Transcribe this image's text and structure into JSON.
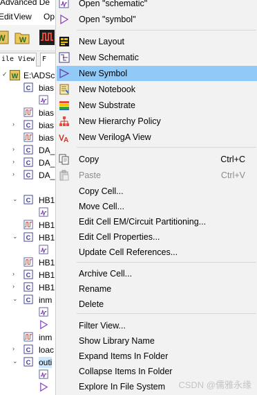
{
  "app": {
    "title_fragment": "Advanced De",
    "menu": [
      "Edit",
      "View",
      "Op"
    ],
    "tabs": [
      "ile View",
      "F"
    ]
  },
  "tree": {
    "root_label": "E:\\ADSc",
    "rows": [
      {
        "label": "bias"
      },
      {
        "label": ""
      },
      {
        "label": "bias"
      },
      {
        "label": "bias"
      },
      {
        "label": "bias"
      },
      {
        "label": "DA_"
      },
      {
        "label": "DA_"
      },
      {
        "label": "DA_"
      },
      {
        "label": "HB1"
      },
      {
        "label": ""
      },
      {
        "label": "HB1"
      },
      {
        "label": "HB1"
      },
      {
        "label": ""
      },
      {
        "label": "HB1"
      },
      {
        "label": "HB1"
      },
      {
        "label": "HB1"
      },
      {
        "label": "inm"
      },
      {
        "label": ""
      },
      {
        "label": ""
      },
      {
        "label": "inm"
      },
      {
        "label": "loac"
      },
      {
        "label": "outi"
      },
      {
        "label": ""
      },
      {
        "label": ""
      }
    ]
  },
  "context_menu": {
    "items": [
      {
        "label": "Open \"schematic\"",
        "icon": "schematic-view-icon",
        "disabled": false,
        "shortcut": ""
      },
      {
        "label": "Open \"symbol\"",
        "icon": "symbol-view-icon",
        "disabled": false,
        "shortcut": ""
      },
      {
        "label": "New Layout",
        "icon": "layout-icon",
        "disabled": false,
        "shortcut": ""
      },
      {
        "label": "New Schematic",
        "icon": "schematic-icon",
        "disabled": false,
        "shortcut": ""
      },
      {
        "label": "New Symbol",
        "icon": "symbol-icon",
        "disabled": false,
        "shortcut": "",
        "highlighted": true
      },
      {
        "label": "New Notebook",
        "icon": "notebook-icon",
        "disabled": false,
        "shortcut": ""
      },
      {
        "label": "New Substrate",
        "icon": "substrate-icon",
        "disabled": false,
        "shortcut": ""
      },
      {
        "label": "New Hierarchy Policy",
        "icon": "hierarchy-icon",
        "disabled": false,
        "shortcut": ""
      },
      {
        "label": "New VerilogA View",
        "icon": "veriloga-icon",
        "disabled": false,
        "shortcut": ""
      },
      {
        "label": "Copy",
        "icon": "copy-icon",
        "disabled": false,
        "shortcut": "Ctrl+C"
      },
      {
        "label": "Paste",
        "icon": "paste-icon",
        "disabled": true,
        "shortcut": "Ctrl+V"
      },
      {
        "label": "Copy Cell...",
        "icon": "",
        "disabled": false,
        "shortcut": ""
      },
      {
        "label": "Move Cell...",
        "icon": "",
        "disabled": false,
        "shortcut": ""
      },
      {
        "label": "Edit Cell EM/Circuit Partitioning...",
        "icon": "",
        "disabled": false,
        "shortcut": ""
      },
      {
        "label": "Edit Cell Properties...",
        "icon": "",
        "disabled": false,
        "shortcut": ""
      },
      {
        "label": "Update Cell References...",
        "icon": "",
        "disabled": false,
        "shortcut": ""
      },
      {
        "label": "Archive Cell...",
        "icon": "",
        "disabled": false,
        "shortcut": ""
      },
      {
        "label": "Rename",
        "icon": "",
        "disabled": false,
        "shortcut": ""
      },
      {
        "label": "Delete",
        "icon": "",
        "disabled": false,
        "shortcut": ""
      },
      {
        "label": "Filter View...",
        "icon": "",
        "disabled": false,
        "shortcut": ""
      },
      {
        "label": "Show Library Name",
        "icon": "",
        "disabled": false,
        "shortcut": ""
      },
      {
        "label": "Expand Items In Folder",
        "icon": "",
        "disabled": false,
        "shortcut": ""
      },
      {
        "label": "Collapse Items In Folder",
        "icon": "",
        "disabled": false,
        "shortcut": ""
      },
      {
        "label": "Explore In File System",
        "icon": "",
        "disabled": false,
        "shortcut": ""
      }
    ]
  },
  "watermark": "CSDN @儒雅永缘",
  "colors": {
    "highlight": "#91c9f7",
    "menu_bg": "#f2f2f2",
    "disabled_text": "#8c8c8c",
    "selected_row": "#cce8ff"
  }
}
